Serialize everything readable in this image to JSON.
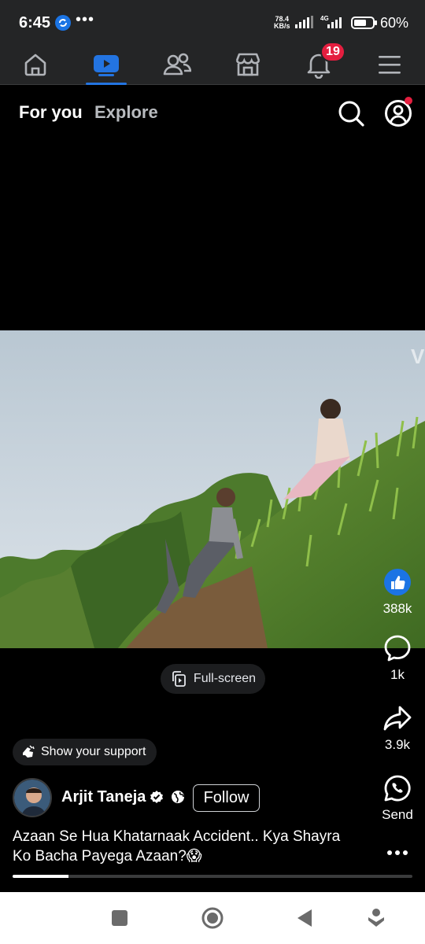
{
  "status_bar": {
    "time": "6:45",
    "dots": "•••",
    "net_speed_value": "78.4",
    "net_speed_unit": "KB/s",
    "network_type": "4G",
    "battery": "60%"
  },
  "nav": {
    "notification_count": "19"
  },
  "header": {
    "tab_foryou": "For you",
    "tab_explore": "Explore"
  },
  "video": {
    "fullscreen_label": "Full-screen",
    "watermark": "V"
  },
  "actions": {
    "likes": "388k",
    "comments": "1k",
    "shares": "3.9k",
    "send": "Send"
  },
  "support_label": "Show your support",
  "author": {
    "name": "Arjit Taneja",
    "follow_label": "Follow"
  },
  "caption": "Azaan Se Hua Khatarnaak Accident.. Kya Shayra Ko Bacha Payega Azaan?😱",
  "progress_fraction": 0.14,
  "colors": {
    "accent": "#2374e1",
    "badge": "#e41e3f",
    "nav_bg": "#242526"
  },
  "icons": [
    "home-icon",
    "watch-icon",
    "friends-icon",
    "marketplace-icon",
    "bell-icon",
    "menu-icon",
    "search-icon",
    "profile-icon",
    "like-icon",
    "comment-icon",
    "share-icon",
    "whatsapp-icon",
    "more-icon"
  ]
}
